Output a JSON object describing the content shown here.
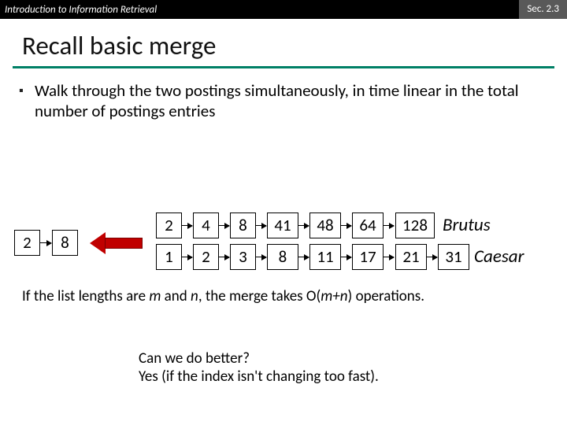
{
  "header": {
    "course": "Introduction to Information Retrieval",
    "section": "Sec. 2.3"
  },
  "title": "Recall basic merge",
  "bullet": "Walk through the two postings simultaneously, in time linear in the total number of postings entries",
  "merged": {
    "a": "2",
    "b": "8"
  },
  "brutus": {
    "label": "Brutus",
    "nodes": [
      "2",
      "4",
      "8",
      "41",
      "48",
      "64",
      "128"
    ]
  },
  "caesar": {
    "label": "Caesar",
    "nodes": [
      "1",
      "2",
      "3",
      "8",
      "11",
      "17",
      "21",
      "31"
    ]
  },
  "complexity_1": "If the list lengths are ",
  "complexity_m": "m",
  "complexity_2": " and ",
  "complexity_n": "n",
  "complexity_3": ", the merge takes O(",
  "complexity_mn": "m+n",
  "complexity_4": ") operations.",
  "qa_q": "Can we do better?",
  "qa_a": "Yes (if the index isn't changing too fast)."
}
